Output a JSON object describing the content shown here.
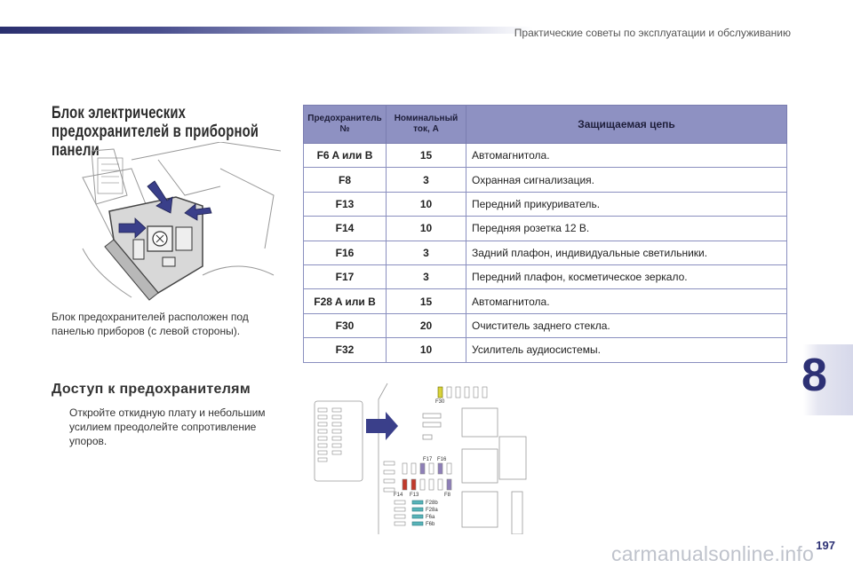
{
  "header": {
    "title": "Практические советы по эксплуатации и обслуживанию"
  },
  "section": {
    "title": "Блок электрических предохранителей в приборной панели"
  },
  "caption": "Блок предохранителей расположен под панелью приборов (с левой стороны).",
  "access": {
    "title": "Доступ к предохранителям",
    "bullet": "",
    "text": "Откройте откидную плату и небольшим усилием преодолейте сопротивление упоров."
  },
  "table": {
    "headers": [
      "Предохранитель №",
      "Номинальный ток, А",
      "Защищаемая цепь"
    ],
    "rows": [
      [
        "F6 A или B",
        "15",
        "Автомагнитола."
      ],
      [
        "F8",
        "3",
        "Охранная сигнализация."
      ],
      [
        "F13",
        "10",
        "Передний прикуриватель."
      ],
      [
        "F14",
        "10",
        "Передняя розетка 12 В."
      ],
      [
        "F16",
        "3",
        "Задний плафон, индивидуальные светильники."
      ],
      [
        "F17",
        "3",
        "Передний плафон, косметическое зеркало."
      ],
      [
        "F28 A или B",
        "15",
        "Автомагнитола."
      ],
      [
        "F30",
        "20",
        "Очиститель заднего стекла."
      ],
      [
        "F32",
        "10",
        "Усилитель аудиосистемы."
      ]
    ]
  },
  "diagram": {
    "labels": {
      "f30": "F30",
      "f17": "F17",
      "f16": "F16",
      "f14": "F14",
      "f13": "F13",
      "f8": "F8",
      "f28b": "F28b",
      "f28a": "F28a",
      "f6a": "F6a",
      "f6b": "F6b"
    },
    "colors": {
      "yellow": "#d8d23a",
      "violet": "#8e7fb8",
      "red": "#c0392b",
      "teal": "#58b3b8",
      "arrow": "#3a3f8a"
    }
  },
  "chapter": {
    "number": "8"
  },
  "page": {
    "number": "197"
  },
  "watermark": "carmanualsonline.info",
  "colors": {
    "accent": "#2d3175",
    "table_header": "#8e91c2",
    "table_border": "#8a8fbf"
  }
}
